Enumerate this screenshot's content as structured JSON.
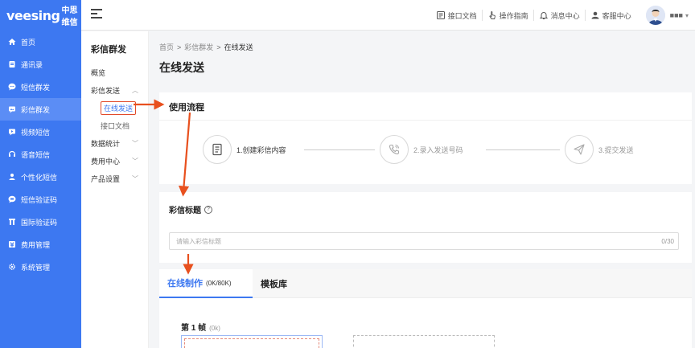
{
  "brand": {
    "logo_main": "veesing",
    "logo_sub": "中思维信"
  },
  "sidebar": {
    "items": [
      {
        "label": "首页",
        "icon": "home-icon",
        "active": false
      },
      {
        "label": "通讯录",
        "icon": "contacts-icon",
        "active": false
      },
      {
        "label": "短信群发",
        "icon": "sms-icon",
        "active": false
      },
      {
        "label": "彩信群发",
        "icon": "mms-icon",
        "active": true
      },
      {
        "label": "视频短信",
        "icon": "video-sms-icon",
        "active": false
      },
      {
        "label": "语音短信",
        "icon": "voice-sms-icon",
        "active": false
      },
      {
        "label": "个性化短信",
        "icon": "personalized-sms-icon",
        "active": false
      },
      {
        "label": "短信验证码",
        "icon": "sms-code-icon",
        "active": false
      },
      {
        "label": "国际验证码",
        "icon": "intl-code-icon",
        "active": false
      },
      {
        "label": "费用管理",
        "icon": "billing-icon",
        "active": false
      },
      {
        "label": "系统管理",
        "icon": "settings-icon",
        "active": false
      }
    ]
  },
  "header": {
    "links": [
      {
        "label": "接口文档",
        "icon": "api-doc-icon"
      },
      {
        "label": "操作指南",
        "icon": "hand-pointer-icon"
      },
      {
        "label": "消息中心",
        "icon": "bell-icon"
      },
      {
        "label": "客服中心",
        "icon": "support-icon"
      }
    ],
    "user_name": "■■■"
  },
  "submenu": {
    "title": "彩信群发",
    "overview": "概览",
    "send_group": "彩信发送",
    "send_online": "在线发送",
    "api_doc": "接口文档",
    "stats": "数据统计",
    "billing": "费用中心",
    "product": "产品设置"
  },
  "main": {
    "breadcrumb": [
      "首页",
      "彩信群发",
      "在线发送"
    ],
    "page_title": "在线发送",
    "flow": {
      "title": "使用流程",
      "steps": [
        {
          "label": "1.创建彩信内容",
          "icon": "document-icon",
          "active": true
        },
        {
          "label": "2.录入发送号码",
          "icon": "phone-call-icon",
          "active": false
        },
        {
          "label": "3.提交发送",
          "icon": "paper-plane-icon",
          "active": false
        }
      ]
    },
    "mms_title": {
      "label": "彩信标题",
      "help": "?",
      "placeholder": "请输入彩信标题",
      "count": "0/30"
    },
    "tabs": {
      "online": "在线制作",
      "quota": "(0K/80K)",
      "template": "模板库"
    },
    "frame": {
      "label": "第 1 帧",
      "size": "(0k)"
    }
  }
}
